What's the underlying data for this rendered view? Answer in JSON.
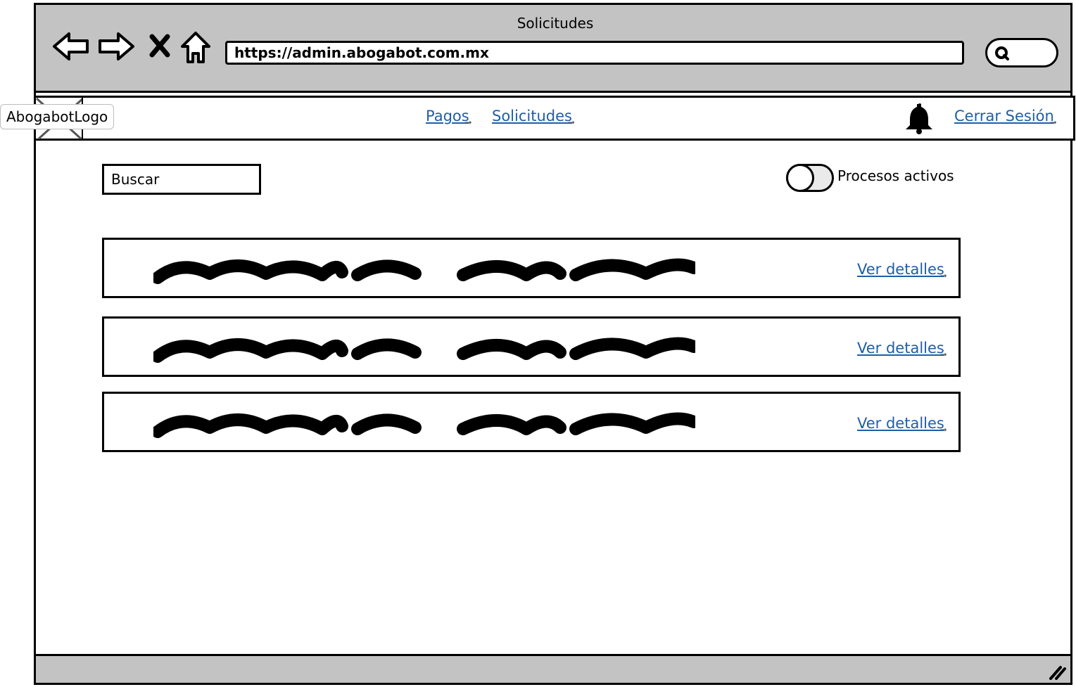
{
  "window": {
    "title": "Solicitudes",
    "url": "https://admin.abogabot.com.mx"
  },
  "header": {
    "logo_label": "AbogabotLogo",
    "nav": [
      {
        "label": "Pagos"
      },
      {
        "label": "Solicitudes"
      }
    ],
    "logout_label": "Cerrar Sesión"
  },
  "toolbar": {
    "search_placeholder": "Buscar",
    "toggle_label": "Procesos activos"
  },
  "requests": [
    {
      "action_label": "Ver detalles"
    },
    {
      "action_label": "Ver detalles"
    },
    {
      "action_label": "Ver detalles"
    }
  ],
  "icons": {
    "back": "arrow-left-icon",
    "forward": "arrow-right-icon",
    "stop": "close-icon",
    "home": "home-icon",
    "search": "search-icon",
    "notifications": "bell-icon",
    "resize": "resize-grip-icon",
    "logo_placeholder": "image-placeholder-icon"
  },
  "colors": {
    "chrome": "#c3c3c3",
    "link": "#1f5ea8",
    "border": "#000000"
  }
}
